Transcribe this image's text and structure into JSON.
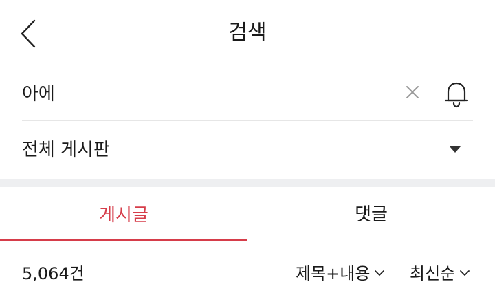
{
  "header": {
    "title": "검색",
    "back_icon": "chevron-left-icon"
  },
  "search": {
    "query": "아에",
    "clear_icon": "close-icon",
    "alert_icon": "bell-icon"
  },
  "board": {
    "label": "전체 게시판",
    "dropdown_icon": "caret-down-icon"
  },
  "tabs": {
    "posts": "게시글",
    "comments": "댓글",
    "active": "posts"
  },
  "results": {
    "count": "5,064건",
    "scope_filter": "제목+내용",
    "sort_filter": "최신순"
  },
  "colors": {
    "accent": "#d63d4a",
    "divider": "#dcdcdc",
    "section_gap": "#eeeff1"
  }
}
